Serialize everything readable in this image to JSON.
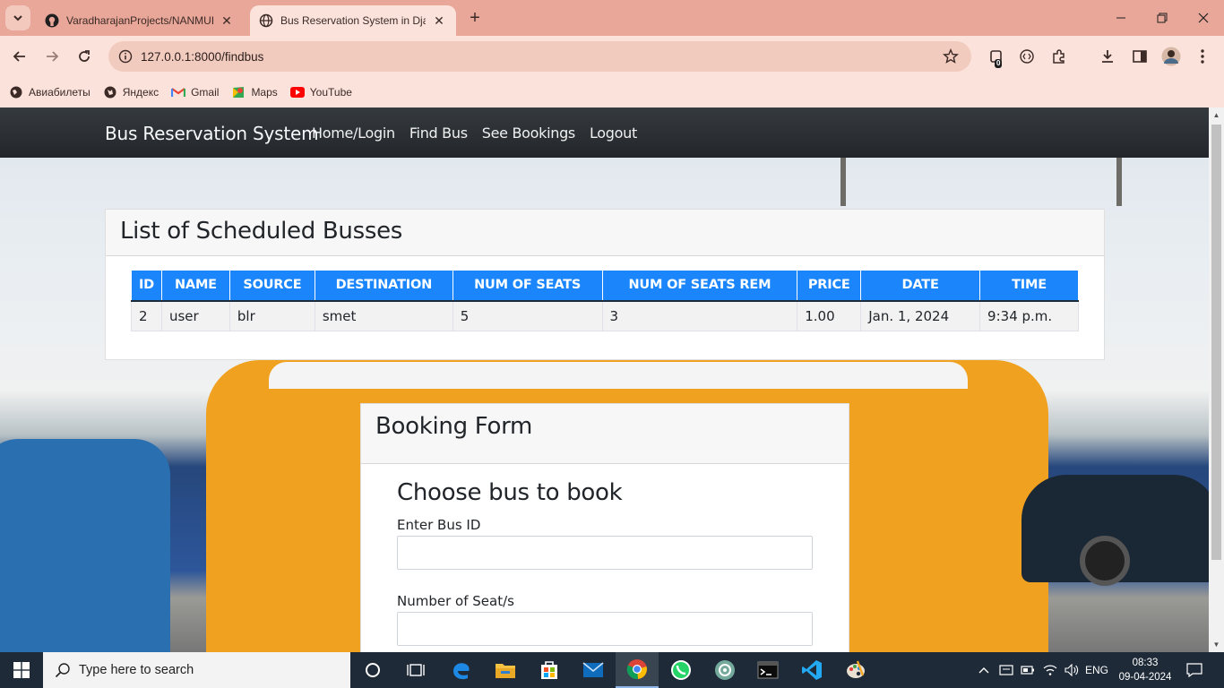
{
  "browser": {
    "tabs": [
      {
        "title": "VaradharajanProjects/NANMUD",
        "active": false
      },
      {
        "title": "Bus Reservation System in Djang",
        "active": true
      }
    ],
    "url": "127.0.0.1:8000/findbus",
    "extension_badge": "0",
    "bookmarks": [
      {
        "label": "Авиабилеты",
        "icon": "globe-icon"
      },
      {
        "label": "Яндекс",
        "icon": "globe-icon"
      },
      {
        "label": "Gmail",
        "icon": "gmail-icon"
      },
      {
        "label": "Maps",
        "icon": "maps-icon"
      },
      {
        "label": "YouTube",
        "icon": "youtube-icon"
      }
    ]
  },
  "navbar": {
    "brand": "Bus Reservation System",
    "links": [
      "Home/Login",
      "Find Bus",
      "See Bookings",
      "Logout"
    ]
  },
  "busses": {
    "title": "List of Scheduled Busses",
    "columns": [
      "ID",
      "NAME",
      "SOURCE",
      "DESTINATION",
      "NUM OF SEATS",
      "NUM OF SEATS REM",
      "PRICE",
      "DATE",
      "TIME"
    ],
    "rows": [
      [
        "2",
        "user",
        "blr",
        "smet",
        "5",
        "3",
        "1.00",
        "Jan. 1, 2024",
        "9:34 p.m."
      ]
    ]
  },
  "booking": {
    "title": "Booking Form",
    "heading": "Choose bus to book",
    "bus_id_label": "Enter Bus ID",
    "seats_label": "Number of Seat/s"
  },
  "taskbar": {
    "search_placeholder": "Type here to search",
    "language": "ENG",
    "time": "08:33",
    "date": "09-04-2024"
  },
  "colors": {
    "table_header": "#1b86fb",
    "navbar": "#343a40",
    "chrome": "#e8a799"
  }
}
